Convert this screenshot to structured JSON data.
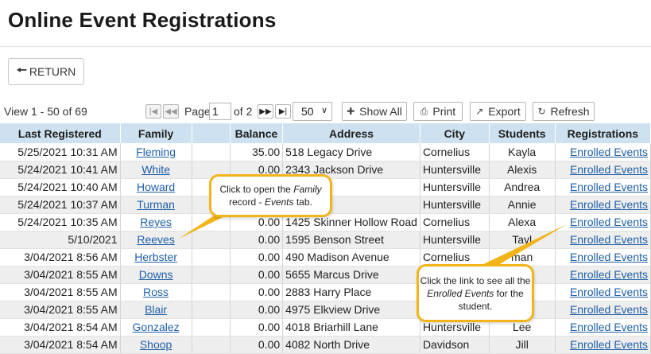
{
  "page": {
    "title": "Online Event Registrations"
  },
  "toolbar": {
    "return_label": "RETURN",
    "view_count": "View 1 - 50 of 69",
    "page_label": "Page",
    "page_value": "1",
    "page_of": "of 2",
    "page_size": "50",
    "show_all": "Show All",
    "print": "Print",
    "export": "Export",
    "refresh": "Refresh"
  },
  "table": {
    "headers": [
      "Last Registered",
      "Family",
      "",
      "Balance",
      "Address",
      "City",
      "Students",
      "Registrations"
    ],
    "rows": [
      {
        "date": "5/25/2021 10:31 AM",
        "family": "Fleming",
        "balance": "35.00",
        "address": "518 Legacy Drive",
        "city": "Cornelius",
        "student": "Kayla",
        "link": "Enrolled Events"
      },
      {
        "date": "5/24/2021 10:41 AM",
        "family": "White",
        "balance": "0.00",
        "address": "2343 Jackson Drive",
        "city": "Huntersville",
        "student": "Alexis",
        "link": "Enrolled Events"
      },
      {
        "date": "5/24/2021 10:40 AM",
        "family": "Howard",
        "balance": "",
        "address": "ot Road",
        "city": "Huntersville",
        "student": "Andrea",
        "link": "Enrolled Events"
      },
      {
        "date": "5/24/2021 10:37 AM",
        "family": "Turman",
        "balance": "",
        "address": "an Way",
        "city": "Huntersville",
        "student": "Annie",
        "link": "Enrolled Events"
      },
      {
        "date": "5/24/2021 10:35 AM",
        "family": "Reyes",
        "balance": "0.00",
        "address": "1425 Skinner Hollow Road",
        "city": "Cornelius",
        "student": "Alexa",
        "link": "Enrolled Events"
      },
      {
        "date": "5/10/2021",
        "family": "Reeves",
        "balance": "0.00",
        "address": "1595 Benson Street",
        "city": "Huntersville",
        "student": "Tayl",
        "link": "Enrolled Events"
      },
      {
        "date": "3/04/2021 8:56 AM",
        "family": "Herbster",
        "balance": "0.00",
        "address": "490 Madison Avenue",
        "city": "Cornelius",
        "student": "man",
        "link": "Enrolled Events"
      },
      {
        "date": "3/04/2021 8:55 AM",
        "family": "Downs",
        "balance": "0.00",
        "address": "5655 Marcus Drive",
        "city": "Huntersville",
        "student": "",
        "link": "Enrolled Events"
      },
      {
        "date": "3/04/2021 8:55 AM",
        "family": "Ross",
        "balance": "0.00",
        "address": "2883 Harry Place",
        "city": "Huntersville",
        "student": "ite",
        "link": "Enrolled Events"
      },
      {
        "date": "3/04/2021 8:55 AM",
        "family": "Blair",
        "balance": "0.00",
        "address": "4975 Elkview Drive",
        "city": "Huntersville",
        "student": "",
        "link": "Enrolled Events"
      },
      {
        "date": "3/04/2021 8:54 AM",
        "family": "Gonzalez",
        "balance": "0.00",
        "address": "4018 Briarhill Lane",
        "city": "Huntersville",
        "student": "Lee",
        "link": "Enrolled Events"
      },
      {
        "date": "3/04/2021 8:54 AM",
        "family": "Shoop",
        "balance": "0.00",
        "address": "4082 North Drive",
        "city": "Davidson",
        "student": "Jill",
        "link": "Enrolled Events"
      }
    ]
  },
  "callouts": {
    "family": {
      "pre": "Click to open the ",
      "em1": "Family",
      "mid": " record - ",
      "em2": "Events",
      "post": " tab."
    },
    "events": {
      "pre": "Click the link to see all the ",
      "em1": "Enrolled Events",
      "post": " for the student."
    }
  },
  "colors": {
    "header_bg": "#cde1f0",
    "link": "#1f5fa8",
    "callout_border": "#f2b418",
    "alt_row": "#eeeeee"
  },
  "icons": {
    "return": "arrow-left-icon",
    "first": "first-page-icon",
    "prev": "prev-page-icon",
    "next": "next-page-icon",
    "last": "last-page-icon",
    "show_all": "plus-icon",
    "print": "print-icon",
    "export": "export-icon",
    "refresh": "refresh-icon"
  }
}
